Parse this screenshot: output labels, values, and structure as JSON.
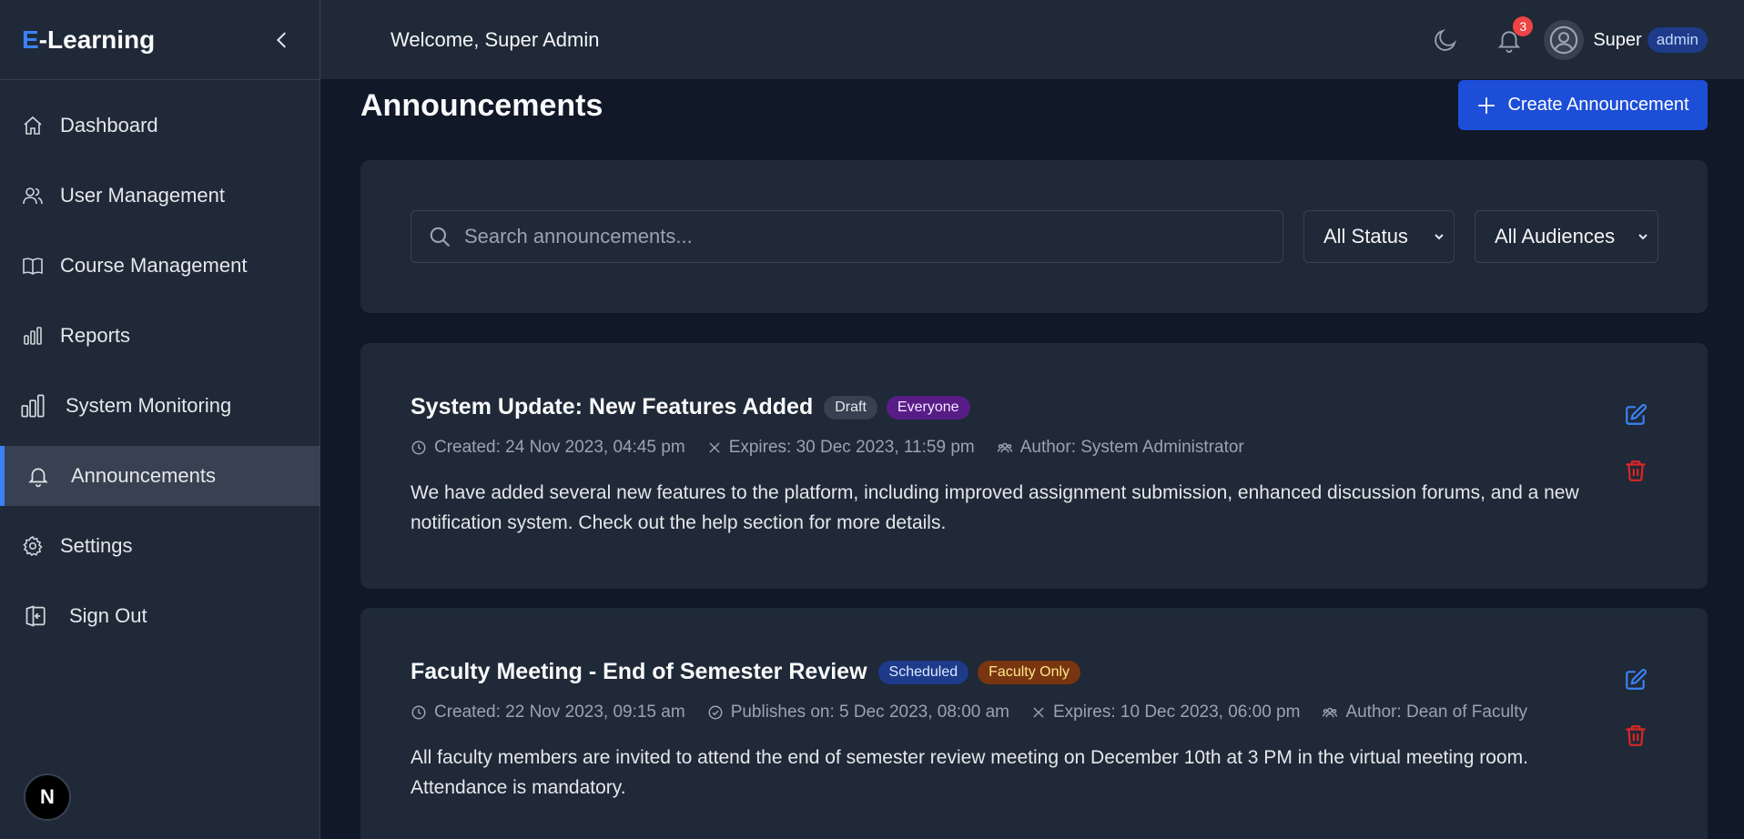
{
  "brand": {
    "prefix": "E",
    "rest": "-Learning"
  },
  "header": {
    "welcome": "Welcome, Super Admin",
    "notification_count": "3",
    "user_name": "Super",
    "role": "admin"
  },
  "sidebar": {
    "items": [
      {
        "label": "Dashboard",
        "icon": "home-icon"
      },
      {
        "label": "User Management",
        "icon": "users-icon"
      },
      {
        "label": "Course Management",
        "icon": "book-icon"
      },
      {
        "label": "Reports",
        "icon": "bar-chart-icon"
      },
      {
        "label": "System Monitoring",
        "icon": "bar-chart-icon"
      },
      {
        "label": "Announcements",
        "icon": "bell-icon",
        "active": true
      },
      {
        "label": "Settings",
        "icon": "gear-icon"
      },
      {
        "label": "Sign Out",
        "icon": "sign-out-icon"
      }
    ],
    "footer_badge": "N"
  },
  "page": {
    "title": "Announcements",
    "create_label": "Create Announcement"
  },
  "filters": {
    "search_placeholder": "Search announcements...",
    "status_selected": "All Status",
    "audience_selected": "All Audiences"
  },
  "announcements": [
    {
      "title": "System Update: New Features Added",
      "status": "Draft",
      "audience": "Everyone",
      "created": "Created: 24 Nov 2023, 04:45 pm",
      "expires": "Expires: 30 Dec 2023, 11:59 pm",
      "author": "Author: System Administrator",
      "body": "We have added several new features to the platform, including improved assignment submission, enhanced discussion forums, and a new notification system. Check out the help section for more details."
    },
    {
      "title": "Faculty Meeting - End of Semester Review",
      "status": "Scheduled",
      "audience": "Faculty Only",
      "created": "Created: 22 Nov 2023, 09:15 am",
      "publishes": "Publishes on: 5 Dec 2023, 08:00 am",
      "expires": "Expires: 10 Dec 2023, 06:00 pm",
      "author": "Author: Dean of Faculty",
      "body": "All faculty members are invited to attend the end of semester review meeting on December 10th at 3 PM in the virtual meeting room. Attendance is mandatory."
    }
  ],
  "colors": {
    "accent": "#3b82f6",
    "primary_button": "#1d4ed8",
    "danger": "#ef4444",
    "panel": "#1f2937",
    "background": "#111827"
  }
}
